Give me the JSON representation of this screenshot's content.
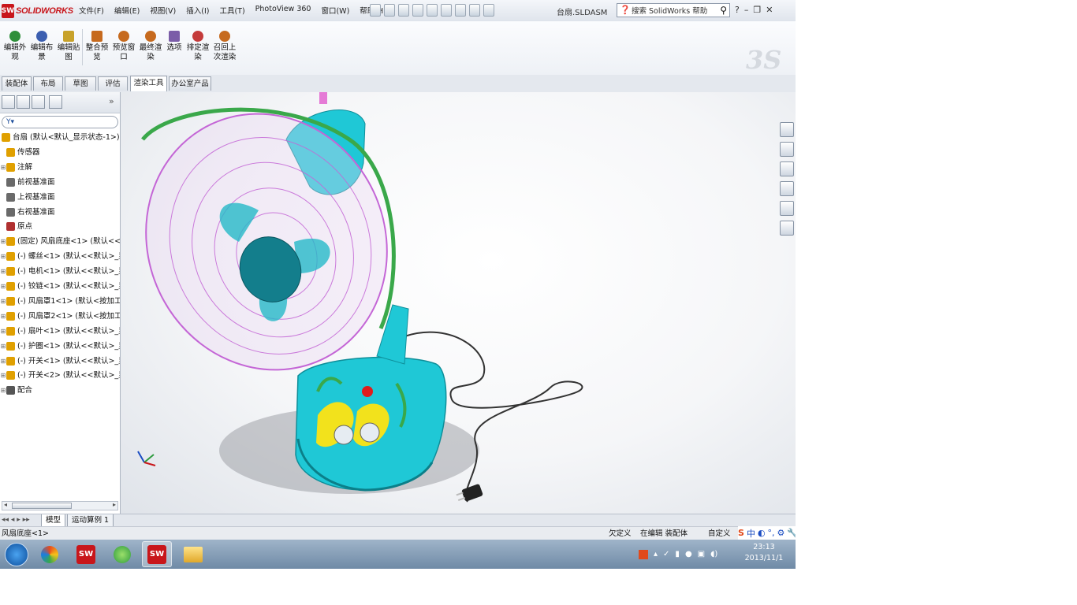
{
  "app": {
    "logo_text": "SOLIDWORKS",
    "logo_mark": "SW",
    "doc_title": "台扇.SLDASM"
  },
  "menu": [
    "文件(F)",
    "编辑(E)",
    "视图(V)",
    "插入(I)",
    "工具(T)",
    "PhotoView 360",
    "窗口(W)",
    "帮助(H)"
  ],
  "help_search": {
    "placeholder": "搜索 SolidWorks 帮助"
  },
  "window_controls": [
    "?",
    "–",
    "❐",
    "✕"
  ],
  "commands": [
    {
      "label": "编辑外观",
      "color": "#2f8f3a"
    },
    {
      "label": "编辑布景",
      "color": "#3c5fb0"
    },
    {
      "label": "编辑贴图",
      "color": "#c8a22a"
    },
    {
      "label": "整合预览",
      "color": "#c66a1e"
    },
    {
      "label": "预览窗口",
      "color": "#c66a1e"
    },
    {
      "label": "最终渲染",
      "color": "#c66a1e"
    },
    {
      "label": "选项",
      "color": "#7b5da8"
    },
    {
      "label": "排定渲染",
      "color": "#c43b3b"
    },
    {
      "label": "召回上次渲染",
      "color": "#c66a1e"
    }
  ],
  "tabs": [
    "装配体",
    "布局",
    "草图",
    "评估",
    "渲染工具",
    "办公室产品"
  ],
  "active_tab": "渲染工具",
  "tree": {
    "filter_label": "Y▾",
    "root": "台扇 (默认<默认_显示状态-1>)",
    "items": [
      {
        "label": "传感器",
        "expand": "",
        "color": "#e0a000"
      },
      {
        "label": "注解",
        "expand": "⊞",
        "color": "#e0a000"
      },
      {
        "label": "前视基准面",
        "expand": "",
        "color": "#6a6a6a"
      },
      {
        "label": "上视基准面",
        "expand": "",
        "color": "#6a6a6a"
      },
      {
        "label": "右视基准面",
        "expand": "",
        "color": "#6a6a6a"
      },
      {
        "label": "原点",
        "expand": "",
        "color": "#b03030"
      },
      {
        "label": "(固定) 风扇底座<1> (默认<<默",
        "expand": "⊞",
        "color": "#e0a000"
      },
      {
        "label": "(-) 螺丝<1> (默认<<默认>_显",
        "expand": "⊞",
        "color": "#e0a000"
      },
      {
        "label": "(-) 电机<1> (默认<<默认>_显",
        "expand": "⊞",
        "color": "#e0a000"
      },
      {
        "label": "(-) 铰链<1> (默认<<默认>_显",
        "expand": "⊞",
        "color": "#e0a000"
      },
      {
        "label": "(-) 风扇罩1<1> (默认<按加工",
        "expand": "⊞",
        "color": "#e0a000"
      },
      {
        "label": "(-) 风扇罩2<1> (默认<按加工",
        "expand": "⊞",
        "color": "#e0a000"
      },
      {
        "label": "(-) 扇叶<1> (默认<<默认>_显",
        "expand": "⊞",
        "color": "#e0a000"
      },
      {
        "label": "(-) 护圈<1> (默认<<默认>_显",
        "expand": "⊞",
        "color": "#e0a000"
      },
      {
        "label": "(-) 开关<1> (默认<<默认>_显",
        "expand": "⊞",
        "color": "#e0a000"
      },
      {
        "label": "(-) 开关<2> (默认<<默认>_显",
        "expand": "⊞",
        "color": "#e0a000"
      },
      {
        "label": "配合",
        "expand": "⊞",
        "color": "#555555"
      }
    ]
  },
  "model_tabs": [
    "模型",
    "运动算例 1"
  ],
  "status": {
    "left": "风扇底座<1>",
    "mid1": "欠定义",
    "mid2": "在编辑 装配体",
    "right": "自定义"
  },
  "ime": [
    "S",
    "中",
    "◐",
    "°,",
    "⚙",
    "🔧"
  ],
  "clock": {
    "time": "23:13",
    "date": "2013/11/1"
  },
  "colors": {
    "fan_body": "#1fc8d6",
    "grille": "#c466d6",
    "ring": "#3aa84a",
    "decal": "#f2e21c"
  }
}
